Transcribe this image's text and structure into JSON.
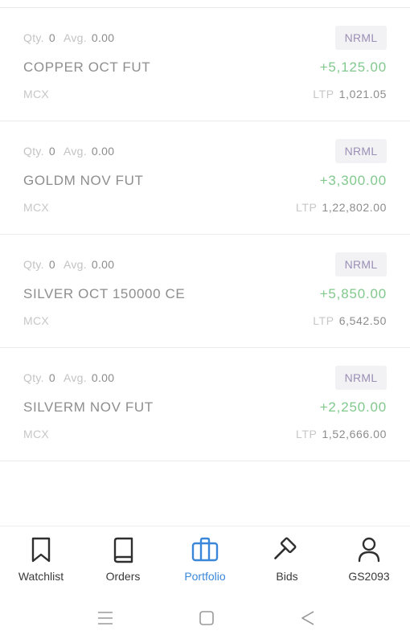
{
  "positions": [
    {
      "qty_label": "Qty.",
      "qty": "0",
      "avg_label": "Avg.",
      "avg": "0.00",
      "product": "NRML",
      "symbol": "COPPER OCT FUT",
      "pnl": "+5,125.00",
      "exchange": "MCX",
      "ltp_label": "LTP",
      "ltp": "1,021.05"
    },
    {
      "qty_label": "Qty.",
      "qty": "0",
      "avg_label": "Avg.",
      "avg": "0.00",
      "product": "NRML",
      "symbol": "GOLDM NOV FUT",
      "pnl": "+3,300.00",
      "exchange": "MCX",
      "ltp_label": "LTP",
      "ltp": "1,22,802.00"
    },
    {
      "qty_label": "Qty.",
      "qty": "0",
      "avg_label": "Avg.",
      "avg": "0.00",
      "product": "NRML",
      "symbol": "SILVER OCT 150000 CE",
      "pnl": "+5,850.00",
      "exchange": "MCX",
      "ltp_label": "LTP",
      "ltp": "6,542.50"
    },
    {
      "qty_label": "Qty.",
      "qty": "0",
      "avg_label": "Avg.",
      "avg": "0.00",
      "product": "NRML",
      "symbol": "SILVERM NOV FUT",
      "pnl": "+2,250.00",
      "exchange": "MCX",
      "ltp_label": "LTP",
      "ltp": "1,52,666.00"
    }
  ],
  "nav": {
    "watchlist": {
      "label": "Watchlist",
      "icon": "bookmark-icon"
    },
    "orders": {
      "label": "Orders",
      "icon": "book-icon"
    },
    "portfolio": {
      "label": "Portfolio",
      "icon": "briefcase-icon",
      "active": true
    },
    "bids": {
      "label": "Bids",
      "icon": "gavel-icon"
    },
    "account": {
      "label": "GS2093",
      "icon": "user-icon"
    }
  },
  "colors": {
    "profit": "#82c98e",
    "accent": "#3a86d8",
    "badge_text": "#9b8fb6",
    "badge_bg": "#f2f2f4"
  },
  "system_bar": {
    "icons": [
      "recent-apps-icon",
      "home-icon",
      "back-icon"
    ]
  }
}
